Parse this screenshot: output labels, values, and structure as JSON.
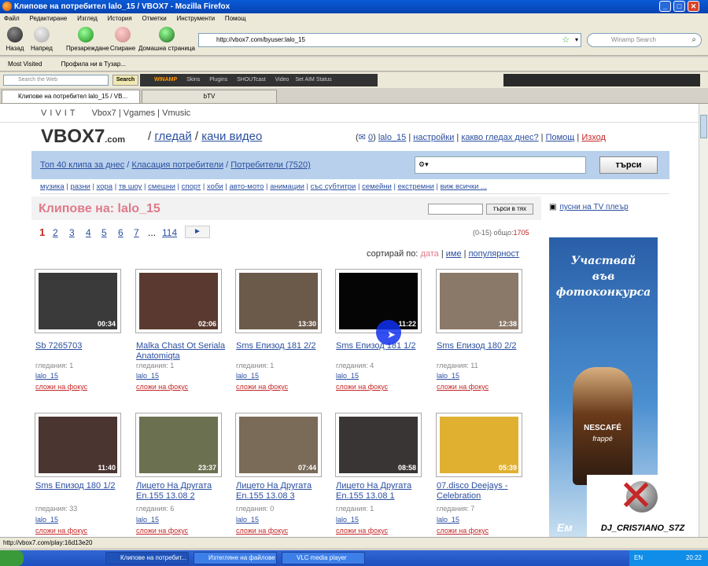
{
  "window": {
    "title": "Клипове на потребител lalo_15 / VBOX7 - Mozilla Firefox"
  },
  "menu": [
    "Файл",
    "Редактиране",
    "Изглед",
    "История",
    "Отметки",
    "Инструменти",
    "Помощ"
  ],
  "nav": {
    "back": "Назад",
    "forward": "Напред",
    "reload": "Презареждане",
    "stop": "Спиране",
    "home": "Домашна страница"
  },
  "url": "http://vbox7.com/byuser:lalo_15",
  "websearch_placeholder": "Winamp Search",
  "bookmarks": {
    "most_visited": "Most Visited",
    "profile": "Профила ни в Тузар..."
  },
  "toolbar": {
    "search_placeholder": "Search the Web",
    "search_btn": "Search",
    "winamp": "WINAMP",
    "skins": "Skins",
    "plugins": "Plugins",
    "shoutcast": "SHOUTcast",
    "video": "Video",
    "aim": "Set AIM Status"
  },
  "tabs": [
    "Клипове на потребител lalo_15 / VB...",
    "bTV"
  ],
  "vivit": {
    "logo": "VIVIT",
    "links": [
      "Vbox7",
      "Vgames",
      "Vmusic"
    ]
  },
  "site": {
    "logo_main": "VBOX7",
    "logo_suffix": ".com",
    "watch": "гледай",
    "upload": "качи видео",
    "mail_count": "0",
    "user": "lalo_15",
    "settings": "настройки",
    "what": "какво гледах днес?",
    "help": "Помощ",
    "exit": "Изход"
  },
  "bluebar": {
    "top40": "Топ 40 клипа за днес",
    "rank": "Класация потребители",
    "users": "Потребители (7520)",
    "search_btn": "търси"
  },
  "categories": [
    "музика",
    "разни",
    "хора",
    "тв шоу",
    "смешни",
    "спорт",
    "хоби",
    "авто-мото",
    "анимации",
    "със субтитри",
    "семейни",
    "екстремни",
    "виж всички ..."
  ],
  "heading": "Клипове на: lalo_15",
  "search_in": "търси в тях",
  "pages": [
    "1",
    "2",
    "3",
    "4",
    "5",
    "6",
    "7",
    "...",
    "114",
    "►"
  ],
  "count_prefix": "(0-15) общо:",
  "count_total": "1705",
  "sort": {
    "label": "сортирай по:",
    "date": "дата",
    "name": "име",
    "popularity": "популярност"
  },
  "tv_player": "пусни на TV плеър",
  "videos": [
    {
      "title": "Sb 7265703",
      "dur": "00:34",
      "views": "гледания: 1",
      "user": "lalo_15",
      "fav": "сложи на фокус",
      "bg": "#3a3a3a"
    },
    {
      "title": "Malka Chast Ot Seriala Anatomiqta",
      "dur": "02:06",
      "views": "гледания: 1",
      "user": "lalo_15",
      "fav": "сложи на фокус",
      "bg": "#5a3a30"
    },
    {
      "title": "Sms Епизод 181 2/2",
      "dur": "13:30",
      "views": "гледания: 1",
      "user": "lalo_15",
      "fav": "сложи на фокус",
      "bg": "#6b5a4a"
    },
    {
      "title": "Sms Епизод 181 1/2",
      "dur": "11:22",
      "views": "гледания: 4",
      "user": "lalo_15",
      "fav": "сложи на фокус",
      "bg": "#050505"
    },
    {
      "title": "Sms Епизод 180 2/2",
      "dur": "12:38",
      "views": "гледания: 11",
      "user": "lalo_15",
      "fav": "сложи на фокус",
      "bg": "#8a7868"
    },
    {
      "title": "Sms Епизод 180 1/2",
      "dur": "11:40",
      "views": "гледания: 33",
      "user": "lalo_15",
      "fav": "сложи на фокус",
      "bg": "#4a3530"
    },
    {
      "title": "Лицето На Другата En.155 13.08 2",
      "dur": "23:37",
      "views": "гледания: 6",
      "user": "lalo_15",
      "fav": "сложи на фокус",
      "bg": "#6b7050"
    },
    {
      "title": "Лицето На Другата En.155 13.08 3",
      "dur": "07:44",
      "views": "гледания: 0",
      "user": "lalo_15",
      "fav": "сложи на фокус",
      "bg": "#7a6a58"
    },
    {
      "title": "Лицето На Другата En.155 13.08 1",
      "dur": "08:58",
      "views": "гледания: 1",
      "user": "lalo_15",
      "fav": "сложи на фокус",
      "bg": "#3a3535"
    },
    {
      "title": "07.disco Deejays - Celebration",
      "dur": "05:39",
      "views": "гледания: 7",
      "user": "lalo_15",
      "fav": "сложи на фокус",
      "bg": "#e0b030"
    }
  ],
  "ad": {
    "text1": "Участвай",
    "text2": "във",
    "text3": "фотоконкурса",
    "brand": "NESCAFÉ",
    "sub": "frappé",
    "bottom": "Ем"
  },
  "watermark": "DJ_CRIS7IANO_S7Z",
  "status": "http://vbox7.com/play:16d13e20",
  "taskbar": {
    "items": [
      "Клипове на потребит...",
      "Изтегляне на файлове",
      "VLC media player"
    ],
    "lang": "EN",
    "time": "20:22"
  }
}
